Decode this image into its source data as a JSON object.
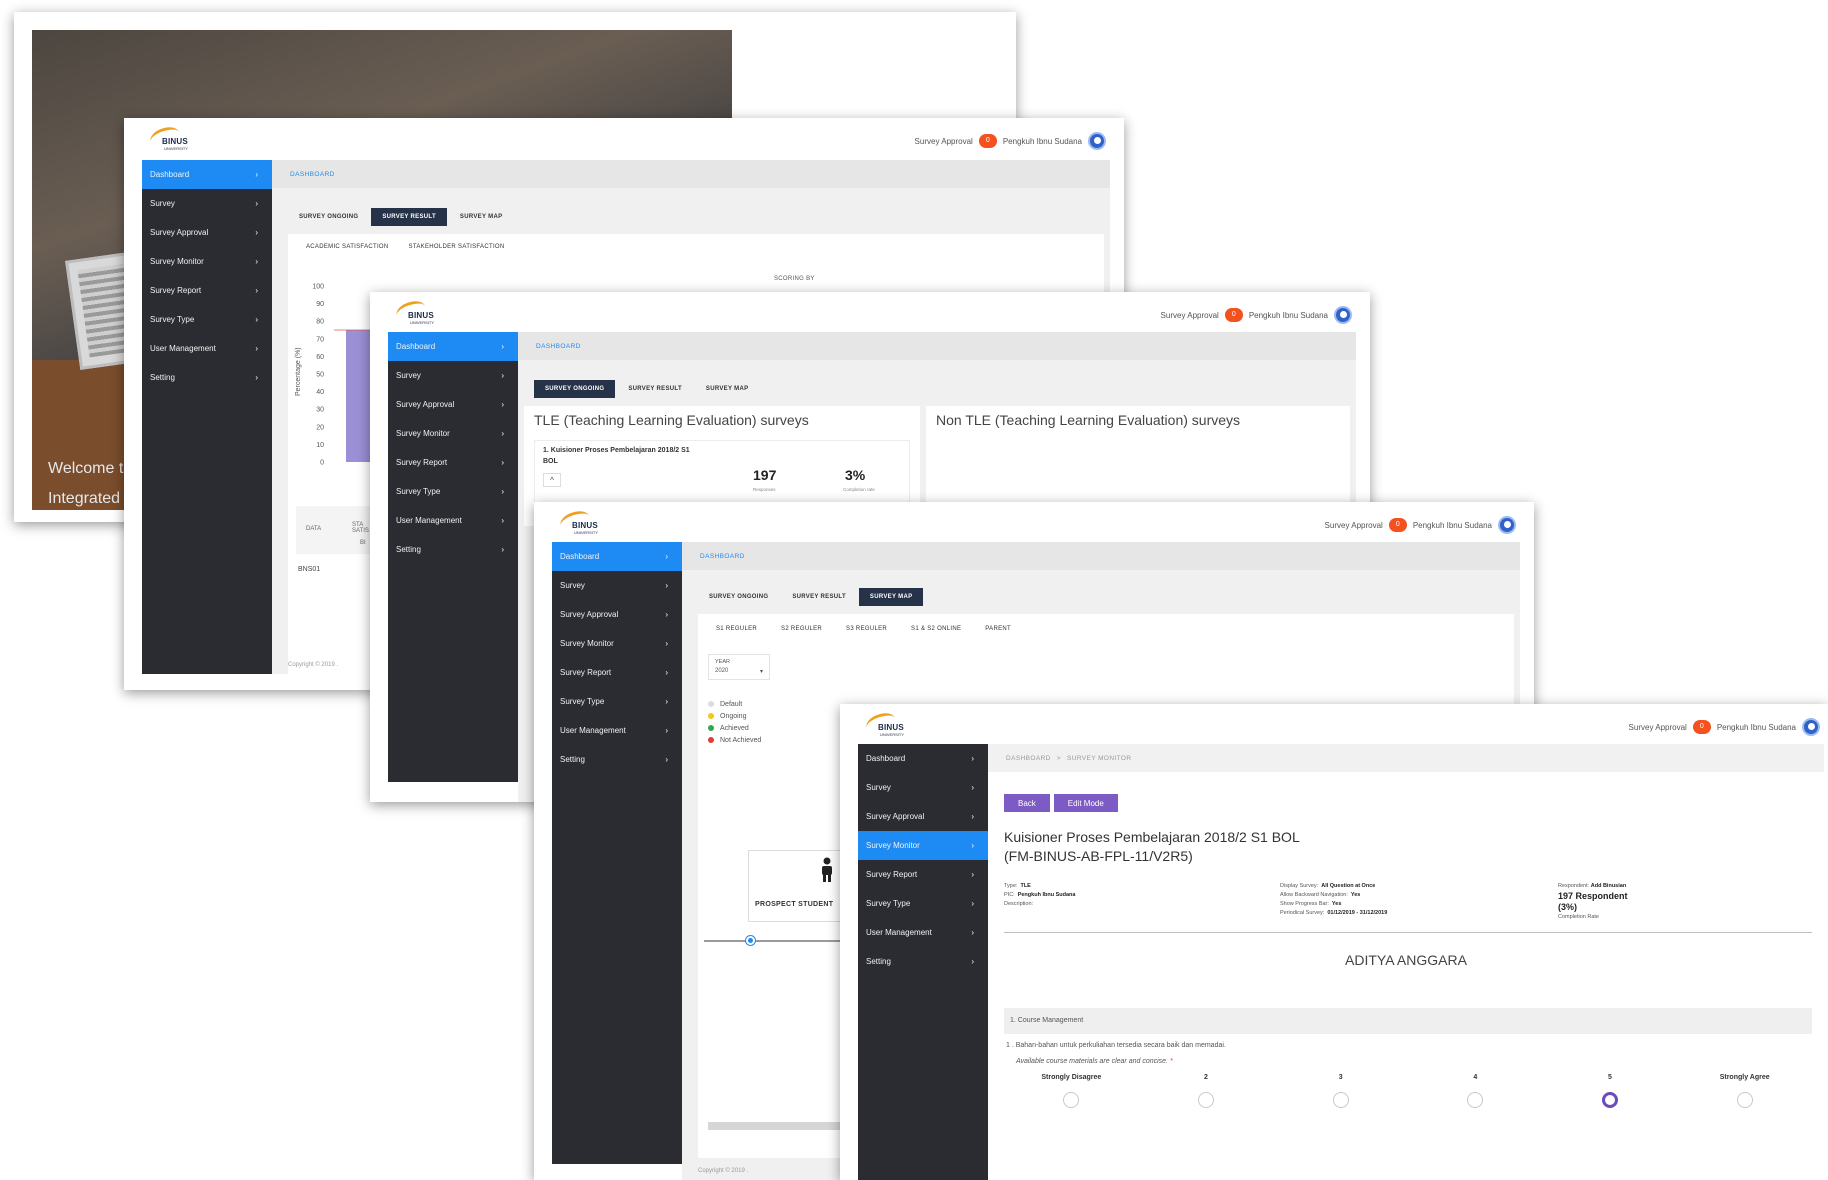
{
  "colors": {
    "sidebar": "#2a2c31",
    "active_blue": "#1e8bf5",
    "tab_dark": "#253247",
    "badge": "#f4511e",
    "purple": "#7c5cc4"
  },
  "brand": {
    "logo_text": "BINUS",
    "logo_sub": "UNIVERSITY"
  },
  "header": {
    "approval_label": "Survey Approval",
    "approval_count": "0",
    "user_name": "Pengkuh Ibnu Sudana"
  },
  "menu": [
    "Dashboard",
    "Survey",
    "Survey Approval",
    "Survey Monitor",
    "Survey Report",
    "Survey Type",
    "User Management",
    "Setting"
  ],
  "copyright": "Copyright © 2019 .",
  "login": {
    "welcome": "Welcome to",
    "line2": "Integrated S"
  },
  "dashboard_result": {
    "breadcrumb": "DASHBOARD",
    "tabs": [
      "SURVEY ONGOING",
      "SURVEY RESULT",
      "SURVEY MAP"
    ],
    "subtabs": [
      "ACADEMIC SATISFACTION",
      "STAKEHOLDER SATISFACTION"
    ],
    "scoring_by": "SCORING BY",
    "table_header": "DATA",
    "table_col": "STA SATIS",
    "table_col2": "BI",
    "table_row": "BNS01"
  },
  "chart_data": {
    "type": "bar",
    "ylabel": "Percentage (%)",
    "ylim": [
      0,
      100
    ],
    "yticks": [
      "100",
      "90",
      "80",
      "70",
      "60",
      "50",
      "40",
      "30",
      "20",
      "10",
      "0"
    ],
    "categories": [
      "BNS01"
    ],
    "values": [
      75
    ]
  },
  "dashboard_ongoing": {
    "breadcrumb": "DASHBOARD",
    "tabs": [
      "SURVEY ONGOING",
      "SURVEY RESULT",
      "SURVEY MAP"
    ],
    "tle_title": "TLE (Teaching Learning Evaluation) surveys",
    "non_tle_title": "Non TLE (Teaching Learning Evaluation) surveys",
    "item_title": "1. Kuisioner Proses Pembelajaran 2018/2 S1",
    "item_title2": "BOL",
    "responses": "197",
    "responses_label": "Responses",
    "completion": "3%",
    "completion_label": "Completion rate"
  },
  "dashboard_map": {
    "breadcrumb": "DASHBOARD",
    "tabs": [
      "SURVEY ONGOING",
      "SURVEY RESULT",
      "SURVEY MAP"
    ],
    "subtabs": [
      "S1 REGULER",
      "S2 REGULER",
      "S3 REGULER",
      "S1 & S2 ONLINE",
      "PARENT"
    ],
    "year_label": "YEAR",
    "year_value": "2020",
    "legend": [
      {
        "label": "Default",
        "color": "#dcdcdc"
      },
      {
        "label": "Ongoing",
        "color": "#f5c518"
      },
      {
        "label": "Achieved",
        "color": "#2eaa4a"
      },
      {
        "label": "Not Achieved",
        "color": "#e53935"
      }
    ],
    "node_label": "PROSPECT STUDENT"
  },
  "monitor": {
    "breadcrumb_1": "DASHBOARD",
    "breadcrumb_sep": ">",
    "breadcrumb_2": "SURVEY MONITOR",
    "back": "Back",
    "edit": "Edit Mode",
    "title_line1": "Kuisioner Proses Pembelajaran 2018/2 S1 BOL",
    "title_line2": "(FM-BINUS-AB-FPL-11/V2R5)",
    "meta_left": [
      {
        "k": "Type:",
        "v": "TLE"
      },
      {
        "k": "PIC:",
        "v": "Pengkuh Ibnu Sudana"
      },
      {
        "k": "Description:",
        "v": ""
      }
    ],
    "meta_mid": [
      {
        "k": "Display Survey:",
        "v": "All Question at Once"
      },
      {
        "k": "Allow Backward Navigation:",
        "v": "Yes"
      },
      {
        "k": "Show Progress Bar:",
        "v": "Yes"
      },
      {
        "k": "Periodical Survey:",
        "v": "01/12/2019 - 31/12/2019"
      }
    ],
    "respondent_label": "Respondent:",
    "respondent_value": "Add Binusian",
    "respondent_count": "197 Respondent",
    "respondent_pct": "(3%)",
    "completion_label": "Completion Rate",
    "person": "ADITYA ANGGARA",
    "section": "1. Course Management",
    "question": "1 . Bahan-bahan untuk perkuliahan tersedia secara baik dan memadai.",
    "question_en": "Available course materials are clear and concise.",
    "required": "*",
    "scale_labels": [
      "Strongly Disagree",
      "2",
      "3",
      "4",
      "5",
      "Strongly Agree"
    ],
    "selected_value": 5
  }
}
